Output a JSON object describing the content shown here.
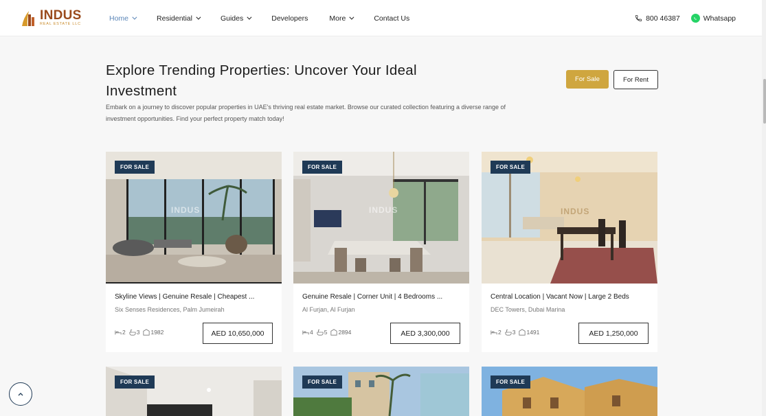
{
  "brand": {
    "name": "INDUS",
    "tagline": "REAL ESTATE LLC",
    "primary_color": "#9a4a1d",
    "accent_color": "#cfa63f",
    "dark_color": "#1f3a56"
  },
  "nav": {
    "items": [
      {
        "label": "Home",
        "active": true,
        "has_dropdown": true
      },
      {
        "label": "Residential",
        "has_dropdown": true
      },
      {
        "label": "Guides",
        "has_dropdown": true
      },
      {
        "label": "Developers",
        "has_dropdown": false
      },
      {
        "label": "More",
        "has_dropdown": true
      },
      {
        "label": "Contact Us",
        "has_dropdown": false
      }
    ]
  },
  "contact": {
    "phone": "800 46387",
    "whatsapp": "Whatsapp",
    "phone_icon": "phone-icon",
    "whatsapp_icon": "whatsapp-icon"
  },
  "intro": {
    "title": "Explore Trending Properties: Uncover Your Ideal Investment",
    "description": "Embark on a journey to discover popular properties in UAE's thriving real estate market. Browse our curated collection featuring a diverse range of investment opportunities. Find your perfect property match today!",
    "filters": {
      "sale": "For Sale",
      "rent": "For Rent",
      "selected": "For Sale"
    }
  },
  "listings": [
    {
      "badge": "FOR SALE",
      "title": "Skyline Views | Genuine Resale | Cheapest ...",
      "location": "Six Senses Residences, Palm Jumeirah",
      "beds": "2",
      "baths": "3",
      "area": "1982",
      "price": "AED 10,650,000"
    },
    {
      "badge": "FOR SALE",
      "title": "Genuine Resale | Corner Unit | 4 Bedrooms ...",
      "location": "Al Furjan, Al Furjan",
      "beds": "4",
      "baths": "5",
      "area": "2894",
      "price": "AED 3,300,000"
    },
    {
      "badge": "FOR SALE",
      "title": "Central Location | Vacant Now | Large 2 Beds",
      "location": "DEC Towers, Dubai Marina",
      "beds": "2",
      "baths": "3",
      "area": "1491",
      "price": "AED 1,250,000"
    },
    {
      "badge": "FOR SALE"
    },
    {
      "badge": "FOR SALE"
    },
    {
      "badge": "FOR SALE"
    }
  ],
  "watermark": "INDUS"
}
